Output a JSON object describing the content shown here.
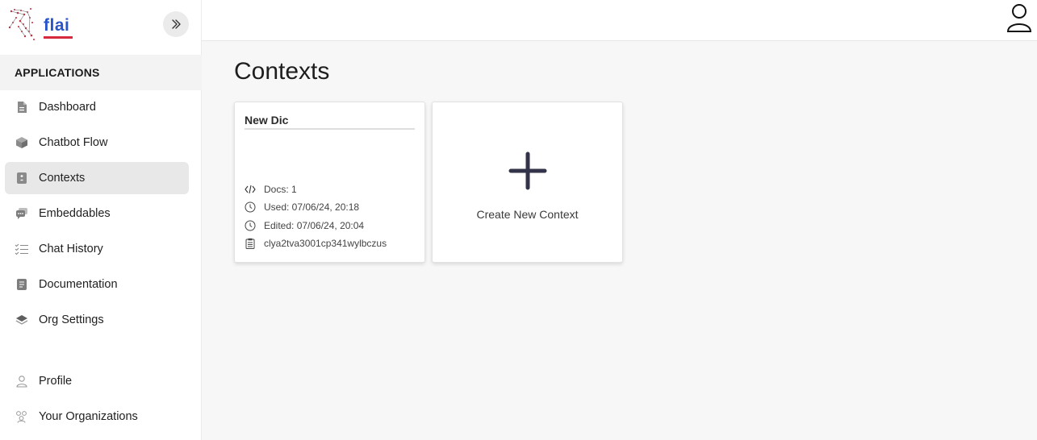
{
  "brand": {
    "name": "flai",
    "logo_icon": "flai-logo-icon"
  },
  "sidebar": {
    "collapse_icon": "chevrons-right-icon",
    "section_title": "APPLICATIONS",
    "items": [
      {
        "label": "Dashboard",
        "icon": "document-icon"
      },
      {
        "label": "Chatbot Flow",
        "icon": "cube-icon"
      },
      {
        "label": "Contexts",
        "icon": "context-icon",
        "active": true
      },
      {
        "label": "Embeddables",
        "icon": "chat-bubbles-icon"
      },
      {
        "label": "Chat History",
        "icon": "checklist-icon"
      },
      {
        "label": "Documentation",
        "icon": "notes-icon"
      },
      {
        "label": "Org Settings",
        "icon": "layers-icon"
      }
    ],
    "bottom_items": [
      {
        "label": "Profile",
        "icon": "user-icon"
      },
      {
        "label": "Your Organizations",
        "icon": "users-icon"
      }
    ]
  },
  "topbar": {
    "user_icon": "user-icon"
  },
  "main": {
    "title": "Contexts",
    "cards": [
      {
        "title": "New Dic",
        "docs": "Docs: 1",
        "used": "Used: 07/06/24, 20:18",
        "edited": "Edited: 07/06/24, 20:04",
        "id": "clya2tva3001cp341wylbczus"
      }
    ],
    "create_label": "Create New Context"
  },
  "colors": {
    "brand_blue": "#2a55c8",
    "brand_red": "#d6293b",
    "plus": "#33334a"
  }
}
